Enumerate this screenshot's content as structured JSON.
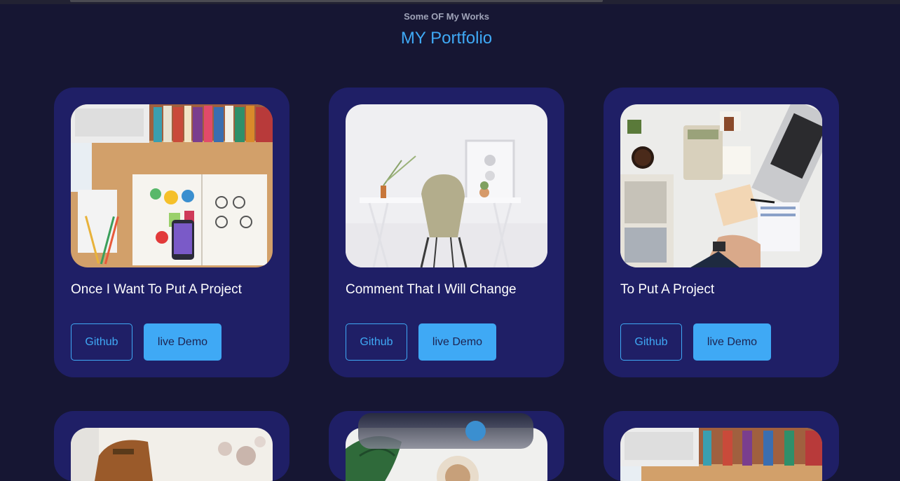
{
  "header": {
    "subtitle": "Some OF My Works",
    "title": "MY Portfolio"
  },
  "projects": [
    {
      "title": "Once I Want To Put A Project",
      "github_label": "Github",
      "demo_label": "live Demo",
      "image": "desk-workspace-photo"
    },
    {
      "title": "Comment That I Will Change",
      "github_label": "Github",
      "demo_label": "live Demo",
      "image": "white-desk-chair-photo"
    },
    {
      "title": "To Put A Project",
      "github_label": "Github",
      "demo_label": "live Demo",
      "image": "office-desk-top-view-photo"
    }
  ],
  "more_projects": [
    {
      "image": "leather-bag-photo"
    },
    {
      "image": "plant-coffee-photo"
    },
    {
      "image": "desk-workspace-photo"
    }
  ],
  "colors": {
    "background": "#161633",
    "card": "#1f1f66",
    "accent": "#3fa9f5",
    "title_text": "#ffffff",
    "subtitle_text": "#9fa3b8"
  }
}
